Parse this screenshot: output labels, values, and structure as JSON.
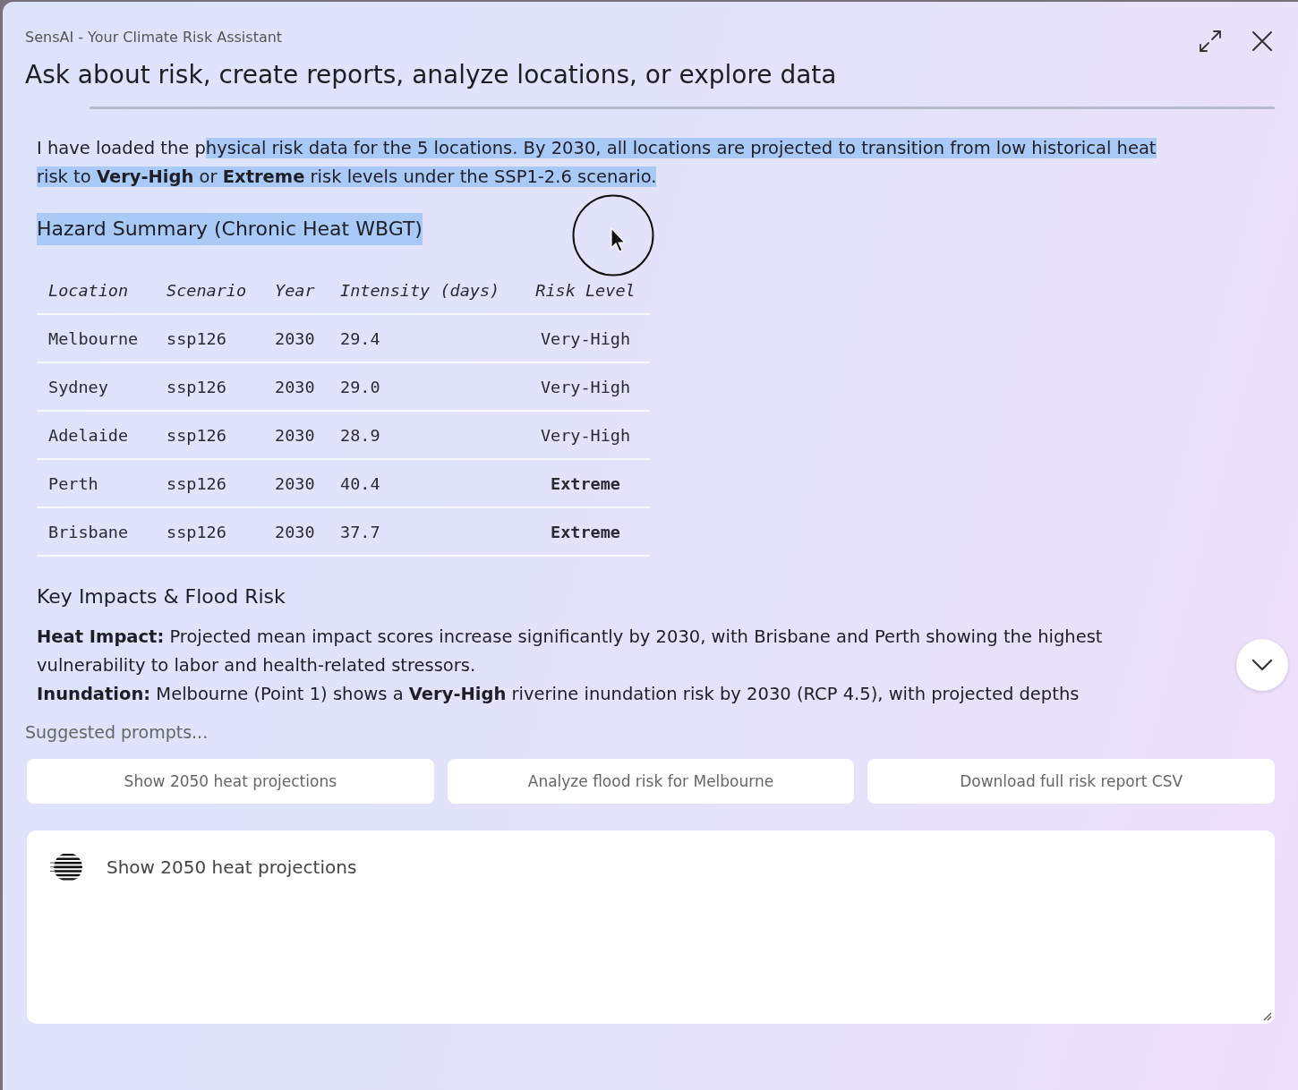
{
  "window": {
    "subtitle": "SensAI - Your Climate Risk Assistant",
    "title": "Ask about risk, create reports, analyze locations, or explore data"
  },
  "message": {
    "intro": [
      {
        "text": "I have loaded the p",
        "highlighted": false
      },
      {
        "text": "hysical risk data for the 5 locations. By 2030, all locations are projected to transition from low historical heat risk to **Very-High** or **Extreme** risk levels under the SSP1-2.6 scenario.",
        "highlighted": true
      }
    ],
    "hazard_heading": {
      "text": "Hazard Summary (Chronic Heat WBGT)",
      "highlighted": true
    },
    "table": {
      "columns": [
        "Location",
        "Scenario",
        "Year",
        "Intensity (days)",
        "Risk Level"
      ],
      "rows": [
        {
          "cells": [
            "Melbourne",
            "ssp126",
            "2030",
            "29.4",
            "Very-High"
          ],
          "emphasized": false
        },
        {
          "cells": [
            "Sydney",
            "ssp126",
            "2030",
            "29.0",
            "Very-High"
          ],
          "emphasized": false
        },
        {
          "cells": [
            "Adelaide",
            "ssp126",
            "2030",
            "28.9",
            "Very-High"
          ],
          "emphasized": false
        },
        {
          "cells": [
            "Perth",
            "ssp126",
            "2030",
            "40.4",
            "Extreme"
          ],
          "emphasized": true
        },
        {
          "cells": [
            "Brisbane",
            "ssp126",
            "2030",
            "37.7",
            "Extreme"
          ],
          "emphasized": true
        }
      ]
    },
    "impacts_heading": "Key Impacts & Flood Risk",
    "impacts": [
      "**Heat Impact:** Projected mean impact scores increase significantly by 2030, with Brisbane and Perth showing the highest vulnerability to labor and health-related stressors.",
      "**Inundation:** Melbourne (Point 1) shows a **Very-High** riverine inundation risk by 2030 (RCP 4.5), with projected depths"
    ]
  },
  "suggested_prompts": {
    "label": "Suggested prompts...",
    "items": [
      "Show 2050 heat projections",
      "Analyze flood risk for Melbourne",
      "Download full risk report CSV"
    ]
  },
  "composer": {
    "value": "Show 2050 heat projections"
  }
}
